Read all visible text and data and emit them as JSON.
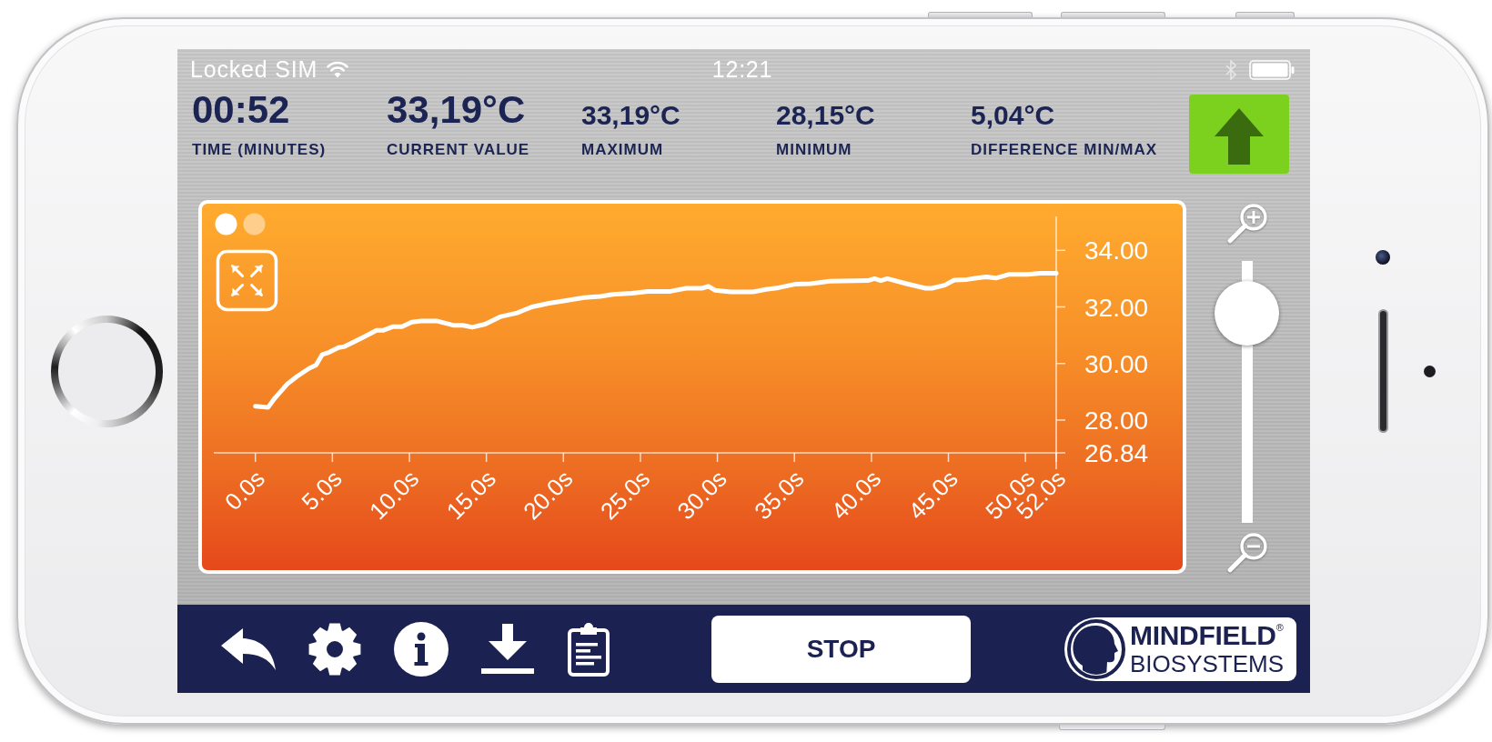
{
  "status_bar": {
    "carrier": "Locked SIM",
    "time": "12:21"
  },
  "readings": [
    {
      "kind": "primary",
      "value": "00:52",
      "label": "TIME (MINUTES)"
    },
    {
      "kind": "primary",
      "value": "33,19°C",
      "label": "CURRENT VALUE"
    },
    {
      "kind": "secondary",
      "value": "33,19°C",
      "label": "MAXIMUM"
    },
    {
      "kind": "secondary",
      "value": "28,15°C",
      "label": "MINIMUM"
    },
    {
      "kind": "secondary",
      "value": "5,04°C",
      "label": "DIFFERENCE MIN/MAX"
    }
  ],
  "chart": {
    "pages": [
      {
        "selected": true
      },
      {
        "selected": false
      }
    ],
    "chart_data": {
      "type": "line",
      "x": [
        0,
        0.83,
        1.24,
        2.07,
        2.7,
        3.5,
        3.94,
        4.35,
        4.77,
        5.39,
        5.8,
        7.05,
        7.87,
        8.29,
        8.91,
        9.53,
        10.15,
        10.77,
        11.81,
        12.85,
        13.47,
        14.09,
        14.92,
        15.95,
        17,
        17.4,
        18.03,
        19.06,
        20.1,
        21.34,
        22.38,
        23.21,
        24.45,
        25.49,
        26.94,
        27.97,
        29,
        29.42,
        29.84,
        30.87,
        32.32,
        33.15,
        33.98,
        35.02,
        36.05,
        37.3,
        39.78,
        40.2,
        40.61,
        41.03,
        42.27,
        43.51,
        43.93,
        44.76,
        45.38,
        46.21,
        46.83,
        47.45,
        48.08,
        48.91,
        50.15,
        50.98,
        52
      ],
      "values": [
        28.49,
        28.45,
        28.76,
        29.27,
        29.54,
        29.83,
        29.94,
        30.32,
        30.39,
        30.56,
        30.6,
        30.94,
        31.17,
        31.17,
        31.3,
        31.3,
        31.46,
        31.5,
        31.5,
        31.35,
        31.35,
        31.28,
        31.39,
        31.66,
        31.79,
        31.88,
        32.01,
        32.13,
        32.22,
        32.33,
        32.37,
        32.44,
        32.48,
        32.55,
        32.55,
        32.66,
        32.66,
        32.73,
        32.59,
        32.53,
        32.53,
        32.62,
        32.68,
        32.8,
        32.82,
        32.91,
        32.93,
        33.0,
        32.93,
        33.0,
        32.82,
        32.66,
        32.66,
        32.77,
        32.95,
        32.97,
        33.02,
        33.06,
        33.02,
        33.15,
        33.15,
        33.19,
        33.19
      ],
      "xlim": [
        -2.7,
        52
      ],
      "ylim": [
        26.84,
        35.2
      ],
      "xticks": [
        {
          "value": 0,
          "label": "0.0s"
        },
        {
          "value": 5,
          "label": "5.0s"
        },
        {
          "value": 10,
          "label": "10.0s"
        },
        {
          "value": 15,
          "label": "15.0s"
        },
        {
          "value": 20,
          "label": "20.0s"
        },
        {
          "value": 25,
          "label": "25.0s"
        },
        {
          "value": 30,
          "label": "30.0s"
        },
        {
          "value": 35,
          "label": "35.0s"
        },
        {
          "value": 40,
          "label": "40.0s"
        },
        {
          "value": 45,
          "label": "45.0s"
        },
        {
          "value": 50,
          "label": "50.0s"
        },
        {
          "value": 52,
          "label": "52.0s"
        }
      ],
      "yticks": [
        {
          "value": 26.84,
          "label": "26.84"
        },
        {
          "value": 28,
          "label": "28.00"
        },
        {
          "value": 30,
          "label": "30.00"
        },
        {
          "value": 32,
          "label": "32.00"
        },
        {
          "value": 34,
          "label": "34.00"
        }
      ]
    }
  },
  "zoom_slider": {
    "level": 0.8
  },
  "toolbar": {
    "stop_button": "STOP",
    "logo": {
      "name": "MINDFIELD$^{®}$",
      "tagline": "BIOSYSTEMS"
    }
  }
}
